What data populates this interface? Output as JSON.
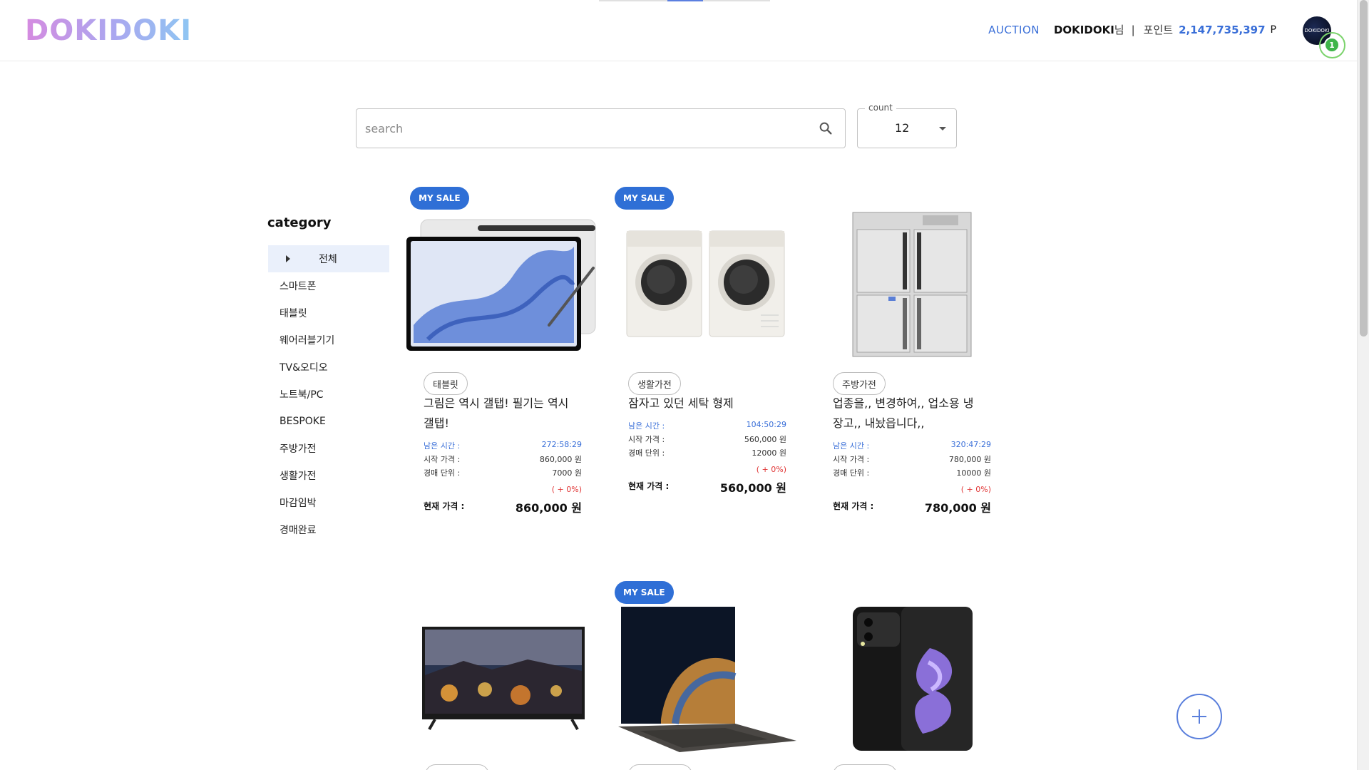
{
  "header": {
    "logo": "DOKIDOKI",
    "auction_label": "AUCTION",
    "user_name": "DOKIDOKI",
    "user_suffix": "님",
    "separator": "|",
    "points_label": "포인트",
    "points_value": "2,147,735,397",
    "points_unit": "P",
    "avatar_text": "DOKIDOKI",
    "notification_count": "1"
  },
  "search": {
    "placeholder": "search",
    "count_label": "count",
    "count_value": "12"
  },
  "sidebar": {
    "title": "category",
    "items": [
      {
        "label": "전체",
        "active": true
      },
      {
        "label": "스마트폰"
      },
      {
        "label": "태블릿"
      },
      {
        "label": "웨어러블기기"
      },
      {
        "label": "TV&오디오"
      },
      {
        "label": "노트북/PC"
      },
      {
        "label": "BESPOKE"
      },
      {
        "label": "주방가전"
      },
      {
        "label": "생활가전"
      },
      {
        "label": "마감임박"
      },
      {
        "label": "경매완료"
      }
    ]
  },
  "labels": {
    "my_sale": "MY SALE",
    "remaining_time": "남은 시간 :",
    "start_price": "시작 가격 :",
    "bid_unit": "경매 단위 :",
    "current_price": "현재 가격 :"
  },
  "products": [
    {
      "my_sale": true,
      "image": "tablet-image",
      "category": "태블릿",
      "title_line1": "그림은 역시 갤탭! 필기는 역시",
      "title_line2": "갤탭!",
      "remaining_time": "272:58:29",
      "start_price": "860,000 원",
      "bid_unit": "7000 원",
      "change": "( + 0%)",
      "current_price": "860,000 원"
    },
    {
      "my_sale": true,
      "image": "washer-dryer-image",
      "category": "생활가전",
      "title_line1": "잠자고 있던 세탁 형제",
      "title_line2": "",
      "remaining_time": "104:50:29",
      "start_price": "560,000 원",
      "bid_unit": "12000 원",
      "change": "( + 0%)",
      "current_price": "560,000 원"
    },
    {
      "my_sale": false,
      "image": "refrigerator-image",
      "category": "주방가전",
      "title_line1": "업종을,, 변경하여,, 업소용 냉",
      "title_line2": "장고,, 내놨읍니다,,",
      "remaining_time": "320:47:29",
      "start_price": "780,000 원",
      "bid_unit": "10000 원",
      "change": "( + 0%)",
      "current_price": "780,000 원"
    },
    {
      "my_sale": false,
      "image": "tv-image"
    },
    {
      "my_sale": true,
      "image": "laptop-image"
    },
    {
      "my_sale": false,
      "image": "foldable-phone-image"
    }
  ],
  "colors": {
    "accent": "#2f6fd6",
    "link": "#3a6fd8",
    "change_red": "#e03434",
    "active_category_bg": "#eaf0fb"
  },
  "icons": {
    "search": "search-icon",
    "add": "plus-icon",
    "caret": "chevron-down-icon"
  }
}
